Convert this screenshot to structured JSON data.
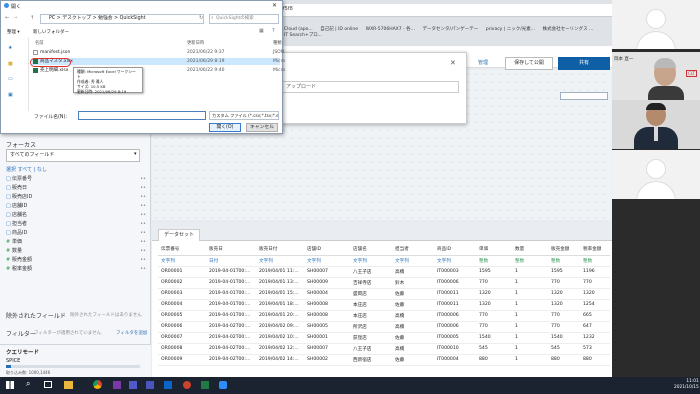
{
  "browser": {
    "url": "...2fe0f5f5f8",
    "bookmarks": [
      "Cloud (apo...",
      "自己記 | ID online",
      "WXR-5706HAX7 - 各...",
      "データセンタ/パンゲーテー",
      "privacy | ニック/光素...",
      "株式会社セーリングス ...",
      "IT Search+プロ..."
    ]
  },
  "app_header": {
    "manage_label": "管理",
    "publish_label": "保存して公開",
    "share_label": "共有"
  },
  "import_modal": {
    "upload_label": "アップロード"
  },
  "file_dialog": {
    "title": "開く",
    "path": "PC > デスクトップ > 勉強会 > QuickSight",
    "search_placeholder": "QuickSightの検索",
    "organize_label": "整理 ▾",
    "new_folder_label": "新しいフォルダー",
    "col_name": "名前",
    "col_date": "更新日時",
    "col_type": "種類",
    "files": [
      {
        "name": "manifest.json",
        "date": "2021/06/22 9:37",
        "type": "JSON"
      },
      {
        "name": "商品マスタ.xlsx",
        "date": "2021/06/29 8:19",
        "type": "Micro"
      },
      {
        "name": "売上明細.xlsx",
        "date": "2021/06/22 9:40",
        "type": "Micro"
      }
    ],
    "tooltip": [
      "種類: Microsoft Excel ワークシート",
      "作成者: 秀 雅人",
      "サイズ: 10.5 KB",
      "更新日時: 2021/06/29 8:19"
    ],
    "filename_label": "ファイル名(N):",
    "filename_value": "",
    "filter_value": "カスタム ファイル (*.csv;*.tsv;*.elf;*.",
    "open_label": "開く(O)",
    "cancel_label": "キャンセル"
  },
  "left_panel": {
    "filter_title": "フォーカス",
    "filter_select": "すべてのフィールド",
    "filter_tabs": "選択  すべて | なし",
    "fields": [
      "伝票番号",
      "販売日",
      "販売店ID",
      "店舗ID",
      "店舗名",
      "担当者",
      "商品ID",
      "単価",
      "数量",
      "販売金額",
      "税率金額"
    ],
    "excluded_title": "除外されたフィールド",
    "excluded_note": "除外されたフィールドはありません",
    "filter_label": "フィルター",
    "filter_note": "フィルターが適用されていません",
    "filter_add": "フィルタを追加",
    "query_title": "クエリモード",
    "query_mode": "SPICE",
    "query_rows": "取り込み数: 1000,1446"
  },
  "dataset": {
    "tab_label": "データセット",
    "columns": [
      "伝票番号",
      "販売日",
      "販売日付",
      "店舗ID",
      "店舗名",
      "担当者",
      "商品ID",
      "単価",
      "数量",
      "販売金額",
      "税率金額"
    ],
    "types": [
      "文字列",
      "日付",
      "文字列",
      "文字列",
      "文字列",
      "文字列",
      "文字列",
      "整数",
      "整数",
      "整数",
      "整数"
    ],
    "rows": [
      [
        "OR00001",
        "2019-04-01T00:...",
        "2019/04/01 11:...",
        "SH00007",
        "八王子店",
        "高橋",
        "IT000003",
        "1595",
        "1",
        "1595",
        "1196"
      ],
      [
        "OR00002",
        "2019-04-01T00:...",
        "2019/04/01 13:...",
        "SH00009",
        "吉祥寺店",
        "鈴木",
        "IT000006",
        "770",
        "1",
        "770",
        "770"
      ],
      [
        "OR00003",
        "2019-04-01T00:...",
        "2019/04/01 15:...",
        "SH00004",
        "盛岡店",
        "佐藤",
        "IT000011",
        "1320",
        "1",
        "1320",
        "1320"
      ],
      [
        "OR00004",
        "2019-04-01T00:...",
        "2019/04/01 18:...",
        "SH00008",
        "本庄店",
        "佐藤",
        "IT000011",
        "1320",
        "1",
        "1320",
        "1254"
      ],
      [
        "OR00005",
        "2019-04-01T00:...",
        "2019/04/01 20:...",
        "SH00008",
        "本庄店",
        "高橋",
        "IT000006",
        "770",
        "1",
        "770",
        "665"
      ],
      [
        "OR00006",
        "2019-04-02T00:...",
        "2019/04/02 09:...",
        "SH00005",
        "所沢店",
        "高橋",
        "IT000006",
        "770",
        "1",
        "770",
        "647"
      ],
      [
        "OR00007",
        "2019-04-02T00:...",
        "2019/04/02 10:...",
        "SH00001",
        "荻窪店",
        "佐藤",
        "IT000005",
        "1540",
        "1",
        "1540",
        "1232"
      ],
      [
        "OR00008",
        "2019-04-02T00:...",
        "2019/04/02 12:...",
        "SH00007",
        "八王子店",
        "高橋",
        "IT000010",
        "545",
        "1",
        "545",
        "573"
      ],
      [
        "OR00009",
        "2019-04-02T00:...",
        "2019/04/02 14:...",
        "SH00002",
        "西新宿店",
        "佐藤",
        "IT000004",
        "880",
        "1",
        "880",
        "880"
      ]
    ]
  },
  "video": {
    "presenter_name": "岡本 直一",
    "badge": "CLT"
  },
  "taskbar": {
    "time": "11:01",
    "date": "2021/10/15"
  }
}
